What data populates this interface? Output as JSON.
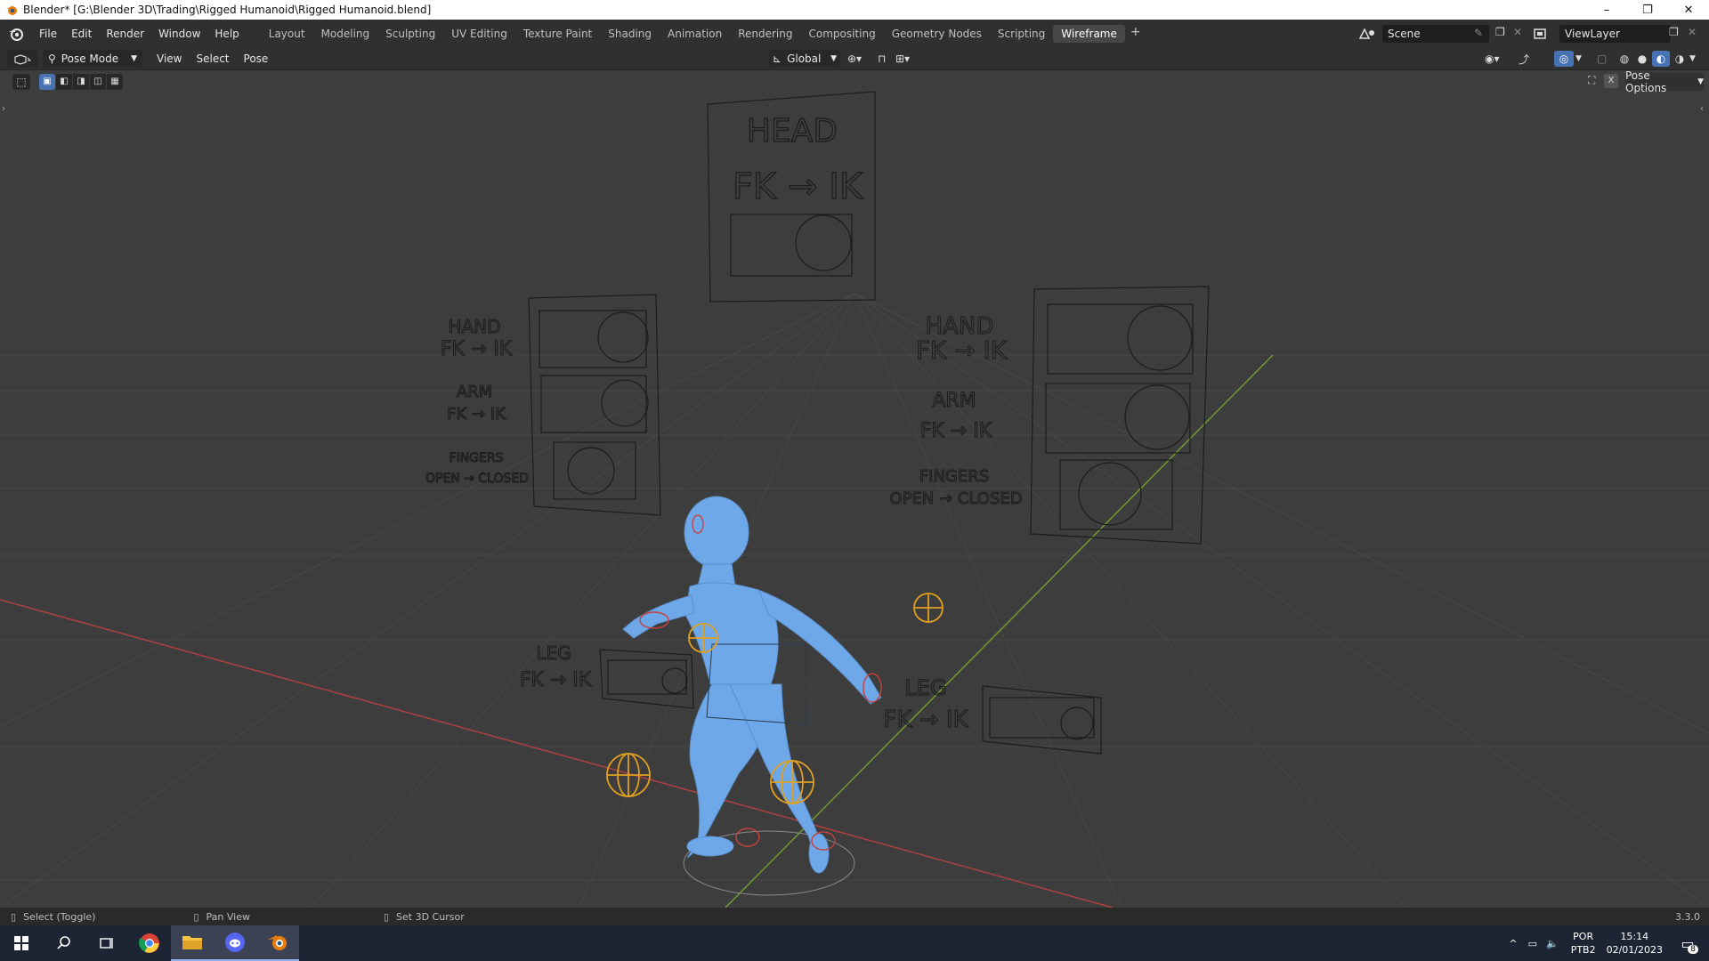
{
  "window": {
    "title": "Blender* [G:\\Blender 3D\\Trading\\Rigged Humanoid\\Rigged Humanoid.blend]",
    "minimize": "–",
    "restore": "❐",
    "close": "✕"
  },
  "menu": [
    "File",
    "Edit",
    "Render",
    "Window",
    "Help"
  ],
  "workspaces": [
    "Layout",
    "Modeling",
    "Sculpting",
    "UV Editing",
    "Texture Paint",
    "Shading",
    "Animation",
    "Rendering",
    "Compositing",
    "Geometry Nodes",
    "Scripting",
    "Wireframe"
  ],
  "active_workspace": "Wireframe",
  "add_workspace": "+",
  "scene_name": "Scene",
  "view_layer": "ViewLayer",
  "header": {
    "mode": "Pose Mode",
    "view_menu": [
      "View",
      "Select",
      "Pose"
    ],
    "transform_orientation": "Global",
    "pose_options": "Pose Options",
    "mirror_x": "X"
  },
  "scene_labels": {
    "head": "HEAD",
    "fk_ik": "FK → IK",
    "hand": "HAND",
    "arm": "ARM",
    "fingers": "FINGERS",
    "open_closed": "OPEN → CLOSED",
    "leg": "LEG"
  },
  "status": {
    "select": "Select (Toggle)",
    "pan": "Pan View",
    "cursor": "Set 3D Cursor",
    "version": "3.3.0"
  },
  "taskbar": {
    "lang": "POR",
    "layout": "PTB2",
    "time": "15:14",
    "date": "02/01/2023",
    "notifications": "8"
  },
  "colors": {
    "accent": "#4772b3",
    "character": "#6fa8e8",
    "x_axis": "#c84040",
    "y_axis": "#7ea83b",
    "control_orange": "#e0a020"
  }
}
